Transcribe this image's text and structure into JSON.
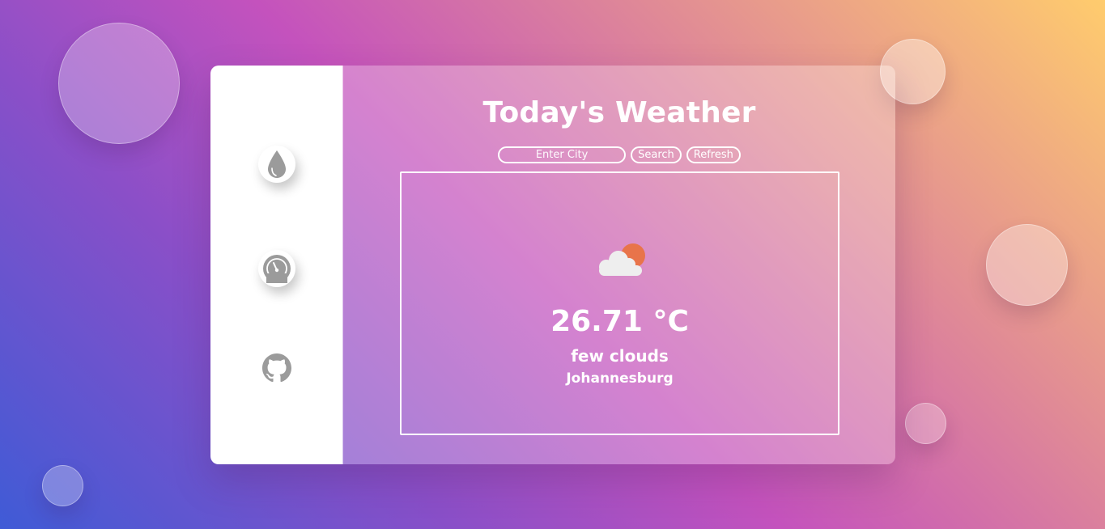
{
  "header": {
    "title": "Today's Weather"
  },
  "search": {
    "placeholder": "Enter City",
    "value": "",
    "search_label": "Search",
    "refresh_label": "Refresh"
  },
  "sidebar": {
    "items": [
      {
        "icon": "water-drop-icon"
      },
      {
        "icon": "gauge-icon"
      },
      {
        "icon": "github-icon"
      }
    ]
  },
  "weather": {
    "icon": "partly-cloudy-icon",
    "temperature": "26.71 °C",
    "description": "few clouds",
    "city": "Johannesburg"
  },
  "colors": {
    "sun": "#e8744a",
    "cloud": "#eeeeee",
    "icon_gray": "#9b9b9b"
  }
}
